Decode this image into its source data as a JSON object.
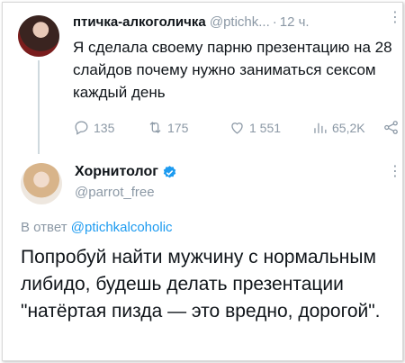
{
  "tweet1": {
    "author_name": "птичка-алкоголичка",
    "author_handle": "@ptichk...",
    "separator": "·",
    "time": "12 ч.",
    "text": "Я сделала своему парню презентацию на 28 слайдов почему нужно заниматься сексом каждый день",
    "stats": {
      "replies": "135",
      "retweets": "175",
      "likes": "1 551",
      "views": "65,2K"
    }
  },
  "tweet2": {
    "author_name": "Хорнитолог",
    "author_handle": "@parrot_free",
    "reply_prefix": "В ответ",
    "reply_target": "@ptichkalcoholic",
    "text": "Попробуй найти мужчину с нормальным либидо, будешь делать презентации \"натёртая пизда — это вредно, дорогой\"."
  },
  "colors": {
    "text": "#0f1419",
    "muted": "#8b98a5",
    "link": "#1d9bf0",
    "verified": "#1d9bf0"
  },
  "icons": [
    "more-icon",
    "reply-icon",
    "retweet-icon",
    "like-icon",
    "views-icon",
    "share-icon",
    "verified-badge-icon"
  ]
}
